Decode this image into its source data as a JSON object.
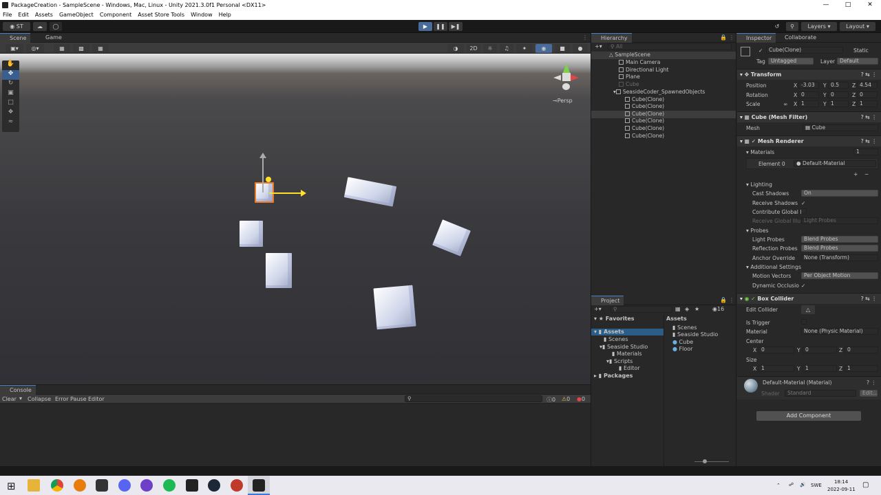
{
  "window": {
    "title": "PackageCreation - SampleScene - Windows, Mac, Linux - Unity 2021.3.0f1 Personal <DX11>"
  },
  "menu": [
    "File",
    "Edit",
    "Assets",
    "GameObject",
    "Component",
    "Asset Store Tools",
    "Window",
    "Help"
  ],
  "toolbar": {
    "account": "ST",
    "layers": "Layers",
    "layout": "Layout"
  },
  "scene": {
    "tabs": [
      "Scene",
      "Game"
    ],
    "mode_2d": "2D",
    "persp": "Persp"
  },
  "hierarchy": {
    "title": "Hierarchy",
    "search_placeholder": "All",
    "items": [
      {
        "label": "SampleScene",
        "depth": 0
      },
      {
        "label": "Main Camera",
        "depth": 1
      },
      {
        "label": "Directional Light",
        "depth": 1
      },
      {
        "label": "Plane",
        "depth": 1
      },
      {
        "label": "Cube",
        "depth": 1
      },
      {
        "label": "SeasideCoder_SpawnedObjects",
        "depth": 1
      },
      {
        "label": "Cube(Clone)",
        "depth": 2
      },
      {
        "label": "Cube(Clone)",
        "depth": 2
      },
      {
        "label": "Cube(Clone)",
        "depth": 2
      },
      {
        "label": "Cube(Clone)",
        "depth": 2
      },
      {
        "label": "Cube(Clone)",
        "depth": 2
      },
      {
        "label": "Cube(Clone)",
        "depth": 2
      }
    ]
  },
  "inspector": {
    "tabs": [
      "Inspector",
      "Collaborate"
    ],
    "object_name": "Cube(Clone)",
    "static": "Static",
    "tag_label": "Tag",
    "tag": "Untagged",
    "layer_label": "Layer",
    "layer": "Default",
    "transform": {
      "title": "Transform",
      "position": {
        "label": "Position",
        "x": "-3.03",
        "y": "0.5",
        "z": "4.54"
      },
      "rotation": {
        "label": "Rotation",
        "x": "0",
        "y": "0",
        "z": "0"
      },
      "scale": {
        "label": "Scale",
        "x": "1",
        "y": "1",
        "z": "1"
      }
    },
    "mesh_filter": {
      "title": "Cube (Mesh Filter)",
      "mesh_label": "Mesh",
      "mesh": "Cube"
    },
    "mesh_renderer": {
      "title": "Mesh Renderer",
      "materials_label": "Materials",
      "materials_count": "1",
      "element0_label": "Element 0",
      "element0": "Default-Material",
      "lighting_label": "Lighting",
      "cast_shadows_label": "Cast Shadows",
      "cast_shadows": "On",
      "receive_shadows_label": "Receive Shadows",
      "contribute_gi_label": "Contribute Global I",
      "receive_gi_label": "Receive Global Illu",
      "receive_gi": "Light Probes",
      "probes_label": "Probes",
      "light_probes_label": "Light Probes",
      "light_probes": "Blend Probes",
      "reflection_probes_label": "Reflection Probes",
      "reflection_probes": "Blend Probes",
      "anchor_override_label": "Anchor Override",
      "anchor_override": "None (Transform)",
      "additional_label": "Additional Settings",
      "motion_vectors_label": "Motion Vectors",
      "motion_vectors": "Per Object Motion",
      "dynamic_occlusion_label": "Dynamic Occlusio"
    },
    "box_collider": {
      "title": "Box Collider",
      "edit_label": "Edit Collider",
      "is_trigger_label": "Is Trigger",
      "material_label": "Material",
      "material": "None (Physic Material)",
      "center_label": "Center",
      "center": {
        "x": "0",
        "y": "0",
        "z": "0"
      },
      "size_label": "Size",
      "size": {
        "x": "1",
        "y": "1",
        "z": "1"
      }
    },
    "material": {
      "name": "Default-Material (Material)",
      "shader_label": "Shader",
      "shader": "Standard",
      "edit": "Edit..."
    },
    "add_component": "Add Component"
  },
  "project": {
    "title": "Project",
    "favorites": "Favorites",
    "count": "16",
    "tree": [
      "Assets",
      "Scenes",
      "Seaside Studio",
      "Materials",
      "Scripts",
      "Editor",
      "Packages"
    ],
    "assets_header": "Assets",
    "assets": [
      "Scenes",
      "Seaside Studio",
      "Cube",
      "Floor"
    ]
  },
  "console": {
    "title": "Console",
    "clear": "Clear",
    "collapse": "Collapse",
    "error_pause": "Error Pause",
    "editor": "Editor",
    "counts": {
      "info": "0",
      "warn": "0",
      "error": "0"
    }
  },
  "tray": {
    "lang": "SWE",
    "time": "18:14",
    "date": "2022-09-11"
  }
}
